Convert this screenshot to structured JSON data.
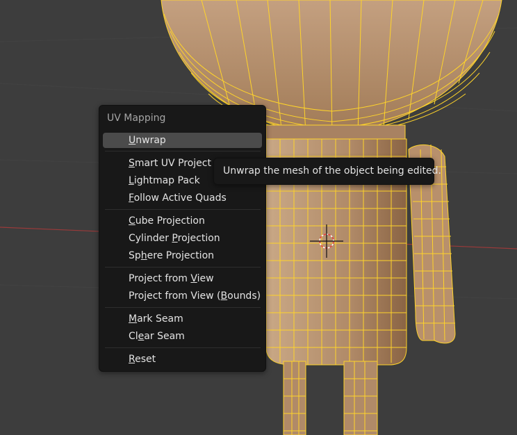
{
  "viewport": {
    "background": "#3d3d3d",
    "mesh_fill": "#b08c6c",
    "wire_color": "#ffd42a",
    "x_axis_color": "#9a3a3a"
  },
  "menu": {
    "title": "UV Mapping",
    "groups": [
      [
        {
          "label": "Unwrap",
          "mnemonic": "U",
          "active": true
        }
      ],
      [
        {
          "label": "Smart UV Project",
          "mnemonic": "S"
        },
        {
          "label": "Lightmap Pack",
          "mnemonic": "L"
        },
        {
          "label": "Follow Active Quads",
          "mnemonic": "F"
        }
      ],
      [
        {
          "label": "Cube Projection",
          "mnemonic": "C"
        },
        {
          "label": "Cylinder Projection",
          "mnemonic": "P"
        },
        {
          "label": "Sphere Projection",
          "mnemonic": "h"
        }
      ],
      [
        {
          "label": "Project from View",
          "mnemonic": "V"
        },
        {
          "label": "Project from View (Bounds)",
          "mnemonic": "B"
        }
      ],
      [
        {
          "label": "Mark Seam",
          "mnemonic": "M"
        },
        {
          "label": "Clear Seam",
          "mnemonic": "e"
        }
      ],
      [
        {
          "label": "Reset",
          "mnemonic": "R"
        }
      ]
    ]
  },
  "tooltip": {
    "text": "Unwrap the mesh of the object being edited."
  }
}
